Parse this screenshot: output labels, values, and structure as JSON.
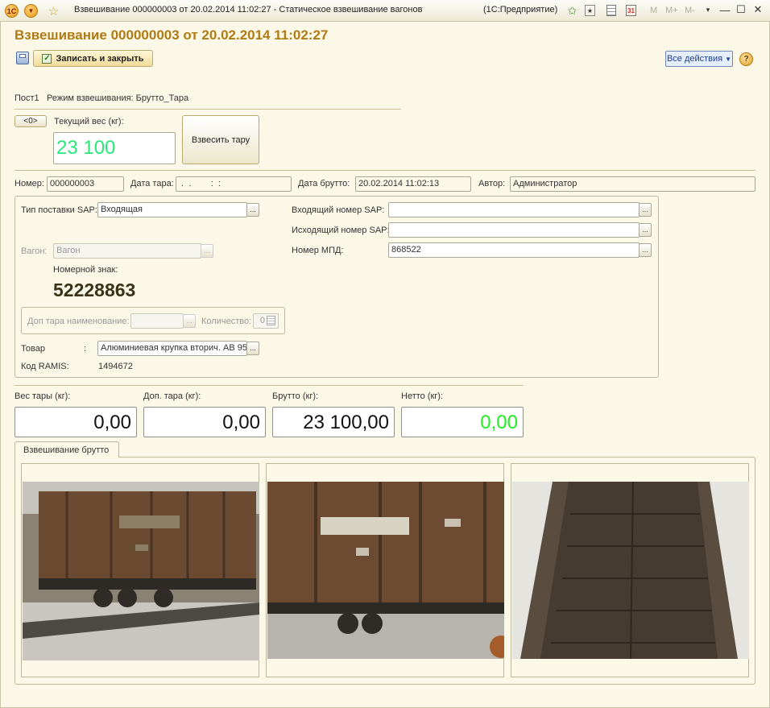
{
  "window": {
    "title": "Взвешивание 000000003 от 20.02.2014 11:02:27 - Статическое взвешивание вагонов",
    "app": "(1С:Предприятие)",
    "icons": [
      "1c-logo-icon",
      "menu-icon",
      "star-icon",
      "favorite-add-icon",
      "bookmark-icon",
      "calculator-icon",
      "calendar-icon"
    ],
    "mem_buttons": [
      "M",
      "M+",
      "M-"
    ]
  },
  "form": {
    "title": "Взвешивание 000000003 от 20.02.2014 11:02:27",
    "save_close": "Записать и закрыть",
    "all_actions": "Все действия",
    "help": "?"
  },
  "weigh": {
    "post": "Пост1",
    "mode": "Режим взвешивания: Брутто_Тара",
    "zero_btn": "<0>",
    "current_weight_label": "Текущий вес (кг):",
    "current_weight": "23 100",
    "weigh_tare_btn": "Взвесить тару"
  },
  "header_fields": {
    "number_label": "Номер:",
    "number": "000000003",
    "tare_date_label": "Дата тара:",
    "tare_date": " .  .        :  :",
    "gross_date_label": "Дата брутто:",
    "gross_date": "20.02.2014 11:02:13",
    "author_label": "Автор:",
    "author": "Администратор"
  },
  "details": {
    "supply_type_label": "Тип поставки SAP:",
    "supply_type": "Входящая",
    "incoming_sap_label": "Входящий номер SAP:",
    "incoming_sap": "",
    "outgoing_sap_label": "Исходящий номер SAP:",
    "outgoing_sap": "",
    "mpd_label": "Номер МПД:",
    "mpd": "868522",
    "wagon_label": "Вагон:",
    "wagon_placeholder": "Вагон",
    "plate_label": "Номерной знак:",
    "plate": "52228863",
    "extra_tare_name_label": "Доп тара наименование:",
    "extra_tare_name": "",
    "qty_label": "Количество:",
    "qty": "0",
    "goods_label": "Товар",
    "goods_colon": ":",
    "goods": "Алюминиевая крупка вторич. АВ 95",
    "ramis_label": "Код RAMIS:",
    "ramis": "1494672"
  },
  "totals": {
    "tare_label": "Вес тары (кг):",
    "tare": "0,00",
    "extra_tare_label": "Доп. тара (кг):",
    "extra_tare": "0,00",
    "gross_label": "Брутто (кг):",
    "gross": "23 100,00",
    "net_label": "Нетто (кг):",
    "net": "0,00"
  },
  "tabs": {
    "active": "Взвешивание брутто"
  },
  "colors": {
    "title_accent": "#b07a14",
    "weight_green": "#28e878",
    "net_green": "#22ee22",
    "background": "#fbf8e8"
  }
}
